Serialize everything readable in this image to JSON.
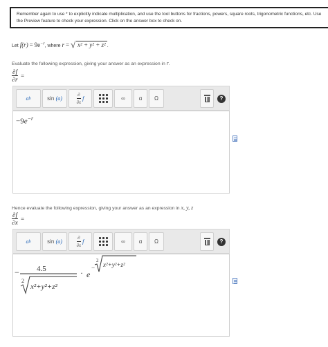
{
  "notice": {
    "text": "Remember again to use * to explicitly indicate multiplication, and use the tool buttons for fractions, powers, square roots, trigonometric functions, etc. Use the Preview feature to check your expression. Click on the answer box to check on."
  },
  "question1": {
    "let_label": "Let",
    "func": "f(r)",
    "equals": "=",
    "coef": "9",
    "exp_base": "e",
    "exp_power": "−r",
    "comma": ",",
    "where_label": "where",
    "r_var": "r",
    "radicand": "x² + y² + z²",
    "period": "."
  },
  "instruction1": {
    "text": "Evaluate the following expression, giving your answer as an expression in",
    "var": "r",
    "end": "."
  },
  "instruction2": {
    "text": "Hence evaluate the following expression, giving your answer as an expression in",
    "vars": "x, y, z"
  },
  "deriv1": {
    "num": "∂f",
    "den": "∂r",
    "eq": "="
  },
  "deriv2": {
    "num": "∂f",
    "den": "∂x",
    "eq": "="
  },
  "toolbar": {
    "power_base": "a",
    "power_exp": "b",
    "sin_label": "sin",
    "sin_arg": "(a)",
    "partial_num": "∂",
    "partial_den": "∂x",
    "partial_f": "f",
    "infinity": "∞",
    "alpha": "α",
    "omega": "Ω",
    "help": "?"
  },
  "answer1": {
    "prefix": "−9",
    "base": "e",
    "exponent": "−r"
  },
  "answer2": {
    "minus": "−",
    "numerator": "4.5",
    "root_index": "2",
    "radicand": "x²+y²+z²",
    "dot": "·",
    "base": "e",
    "exp_minus": "−",
    "exp_root_index": "2"
  },
  "icons": {
    "preview": "document-preview-icon",
    "trash": "trash-icon",
    "help": "help-icon",
    "grid": "matrix-grid-icon"
  }
}
